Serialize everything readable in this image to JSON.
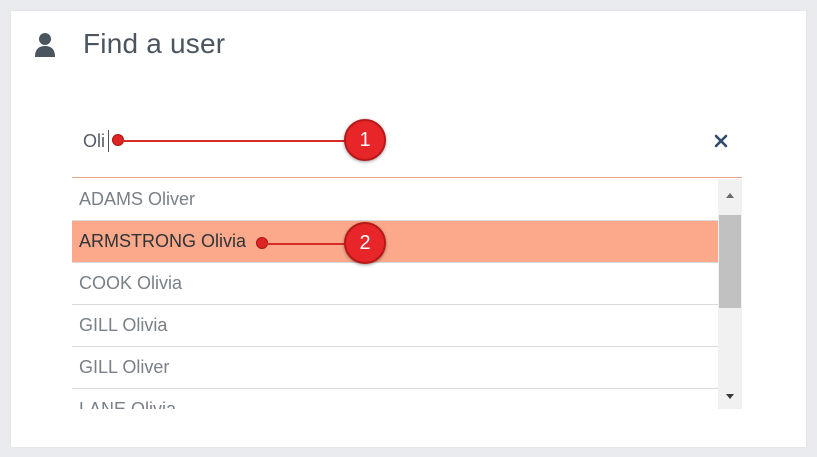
{
  "header": {
    "title": "Find a user",
    "icon": "user-icon"
  },
  "search": {
    "value": "Oli",
    "clear_icon": "close-icon"
  },
  "results": [
    {
      "label": "ADAMS Oliver",
      "selected": false
    },
    {
      "label": "ARMSTRONG Olivia",
      "selected": true
    },
    {
      "label": "COOK Olivia",
      "selected": false
    },
    {
      "label": "GILL Olivia",
      "selected": false
    },
    {
      "label": "GILL Oliver",
      "selected": false
    },
    {
      "label": "LANE Olivia",
      "selected": false
    }
  ],
  "callouts": {
    "first": "1",
    "second": "2"
  },
  "colors": {
    "accent": "#fba98a",
    "callout": "#e8262a",
    "title": "#4a5560"
  }
}
